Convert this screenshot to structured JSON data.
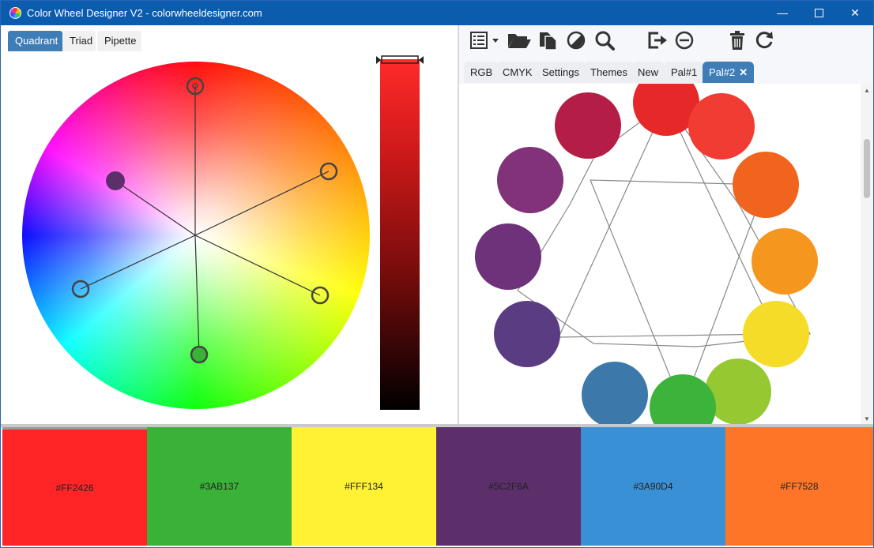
{
  "window": {
    "title": "Color Wheel Designer V2 - colorwheeldesigner.com",
    "controls": {
      "minimize": "—",
      "close": "✕"
    }
  },
  "left_tabs": [
    {
      "label": "Quadrant",
      "active": true
    },
    {
      "label": "Triad",
      "active": false
    },
    {
      "label": "Pipette",
      "active": false
    }
  ],
  "toolbar_icons": [
    "list-icon",
    "dropdown-caret-icon",
    "open-folder-icon",
    "copy-icon",
    "contrast-icon",
    "search-icon",
    "export-icon",
    "remove-icon",
    "trash-icon",
    "refresh-icon"
  ],
  "right_tabs": [
    {
      "label": "RGB",
      "active": false
    },
    {
      "label": "CMYK",
      "active": false
    },
    {
      "label": "Settings",
      "active": false
    },
    {
      "label": "Themes",
      "active": false
    },
    {
      "label": "New",
      "active": false
    },
    {
      "label": "Pal#1",
      "active": false
    },
    {
      "label": "Pal#2",
      "active": true,
      "close_glyph": "✕"
    }
  ],
  "brightness_level": 1.0,
  "palette_circle_colors": [
    "#e62828",
    "#f03c32",
    "#f0641e",
    "#f5961e",
    "#f5dc28",
    "#96c832",
    "#3cb43c",
    "#3c78aa",
    "#5a3c82",
    "#6e327a",
    "#823278",
    "#b41e46"
  ],
  "swatches": [
    {
      "hex": "#FF2426",
      "color": "#ff2426",
      "selected": true
    },
    {
      "hex": "#3AB137",
      "color": "#3ab137",
      "selected": false
    },
    {
      "hex": "#FFF134",
      "color": "#fff134",
      "selected": false
    },
    {
      "hex": "#5C2F6A",
      "color": "#5c2f6a",
      "selected": false
    },
    {
      "hex": "#3A90D4",
      "color": "#3a90d4",
      "selected": false
    },
    {
      "hex": "#FF7528",
      "color": "#ff7528",
      "selected": false
    }
  ]
}
